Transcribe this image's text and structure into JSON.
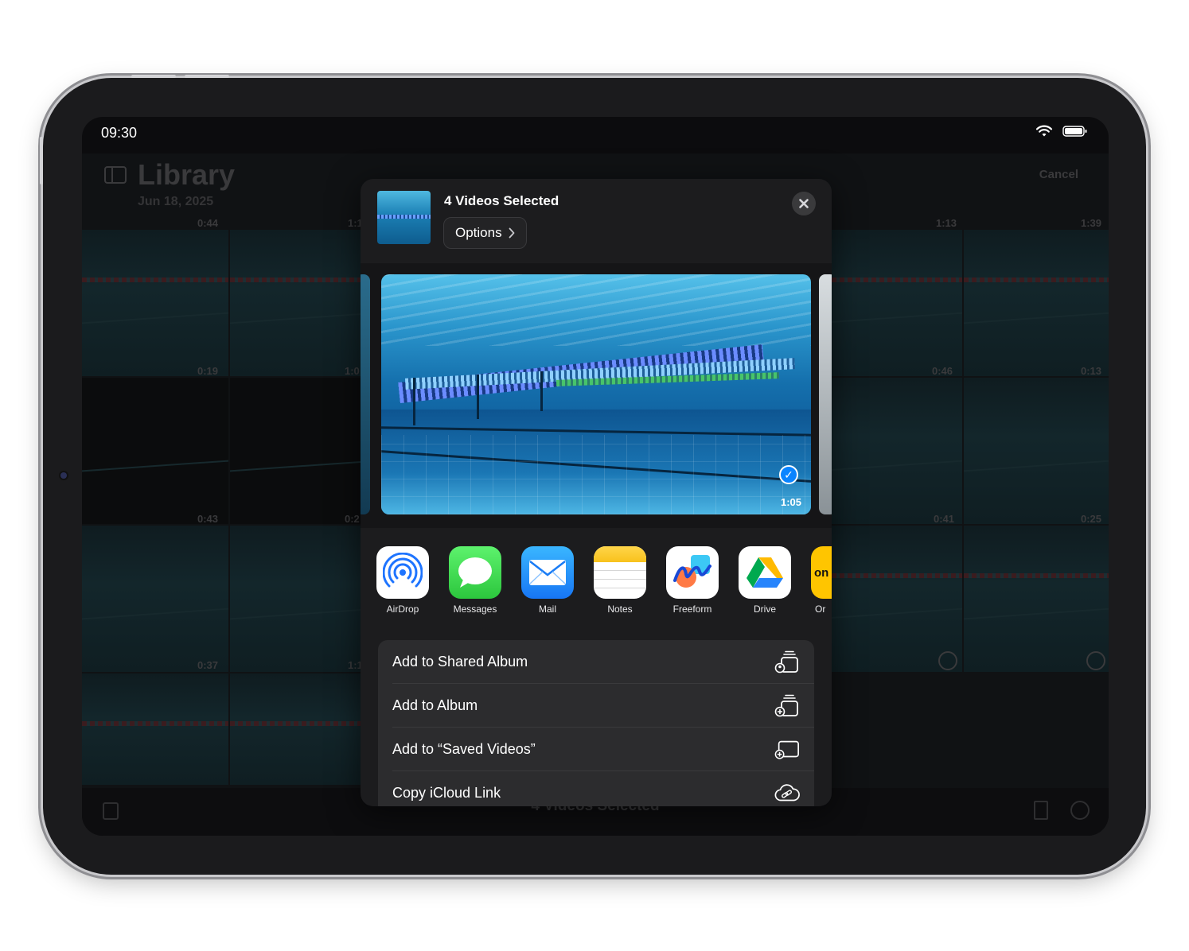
{
  "status_bar": {
    "time": "09:30"
  },
  "library": {
    "title": "Library",
    "date": "Jun 18, 2025",
    "cancel_label": "Cancel",
    "bottom_title": "4 Videos Selected",
    "durations": [
      "0:44",
      "1:1",
      "1:13",
      "1:39",
      "0:19",
      "1:0",
      "0:46",
      "0:13",
      "0:43",
      "0:2",
      "0:41",
      "0:25",
      "0:37",
      "1:1"
    ]
  },
  "share_sheet": {
    "title": "4 Videos Selected",
    "options_label": "Options",
    "preview_duration": "1:05",
    "apps": [
      {
        "label": "AirDrop",
        "icon": "airdrop-icon"
      },
      {
        "label": "Messages",
        "icon": "messages-icon"
      },
      {
        "label": "Mail",
        "icon": "mail-icon"
      },
      {
        "label": "Notes",
        "icon": "notes-icon"
      },
      {
        "label": "Freeform",
        "icon": "freeform-icon"
      },
      {
        "label": "Drive",
        "icon": "drive-icon"
      },
      {
        "label": "Or",
        "icon": "onedrive-partial-icon"
      }
    ],
    "actions": [
      {
        "label": "Add to Shared Album",
        "icon": "shared-album-add-icon"
      },
      {
        "label": "Add to Album",
        "icon": "album-add-icon"
      },
      {
        "label": "Add to “Saved Videos”",
        "icon": "saved-videos-add-icon"
      },
      {
        "label": "Copy iCloud Link",
        "icon": "icloud-link-icon"
      }
    ]
  },
  "colors": {
    "accent": "#0a84ff",
    "sheet_bg": "#1c1c1e",
    "row_bg": "#2c2c2e"
  }
}
